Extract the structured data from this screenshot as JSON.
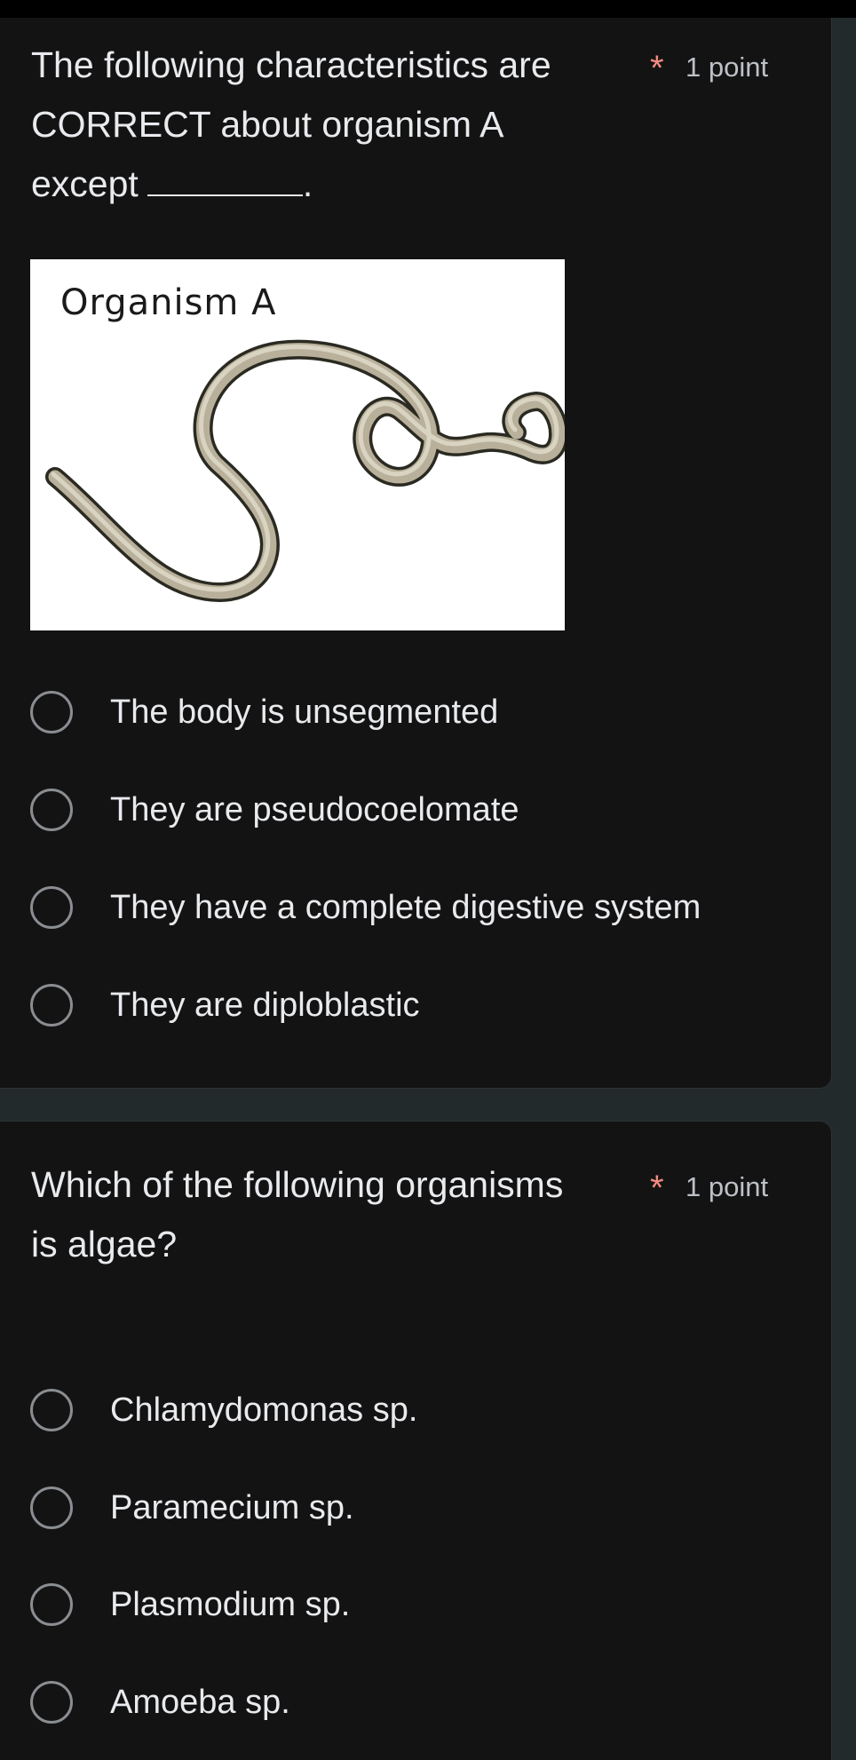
{
  "questions": [
    {
      "title_line1": "The following characteristics are",
      "title_line2": "CORRECT about organism A",
      "title_line3": "except",
      "title_line3_end": ".",
      "required_marker": "*",
      "points": "1 point",
      "figure_label": "Organism A",
      "options": [
        "The body is unsegmented",
        "They are pseudocoelomate",
        "They have a complete digestive system",
        "They are diploblastic"
      ]
    },
    {
      "title_line1": "Which of the following organisms",
      "title_line2": "is algae?",
      "required_marker": "*",
      "points": "1 point",
      "options": [
        "Chlamydomonas sp.",
        "Paramecium sp.",
        "Plasmodium sp.",
        "Amoeba sp."
      ]
    }
  ],
  "colors": {
    "card_background": "#131313",
    "page_background": "#222a2b",
    "required_star": "#f28b82",
    "radio_border": "#8a8d91"
  },
  "icons": {
    "option_control": "radio-unchecked-icon",
    "figure": "roundworm-illustration"
  }
}
